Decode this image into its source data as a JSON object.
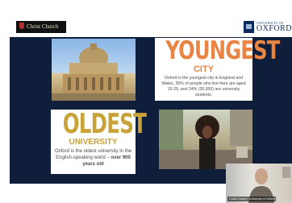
{
  "slide": {
    "logos": {
      "christ_church": "Christ Church",
      "oxford_small": "UNIVERSITY OF",
      "oxford_big": "OXFORD"
    },
    "youngest": {
      "headline": "YOUNGEST",
      "subhead": "CITY",
      "text": "Oxford is the youngest city in England and Wales, 35% of people who live here are aged 15-29, and 24% (30,000) are university students."
    },
    "oldest": {
      "headline": "OLDEST",
      "subhead": "UNIVERSITY",
      "text_1": "Oxford is the oldest university in the English-speaking world –",
      "text_2": "over 900 years old"
    }
  },
  "webcam": {
    "name_label": "Christ Church | University of Oxford"
  },
  "colors": {
    "slide_background": "#0f1f3b",
    "youngest_accent": "#e98443",
    "oldest_accent": "#c9a23a"
  }
}
